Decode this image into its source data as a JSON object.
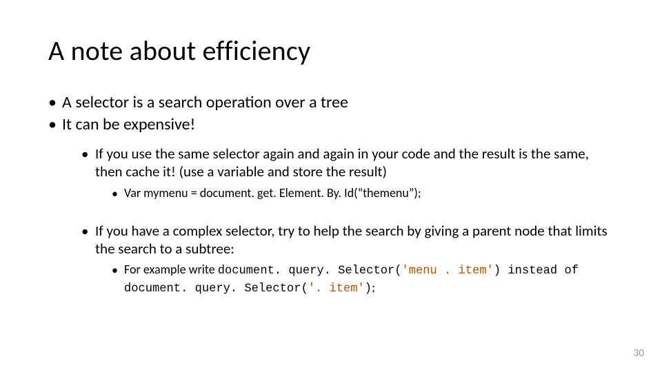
{
  "title": "A note about efficiency",
  "b1": "A selector is a search operation over a tree",
  "b2": "It can be expensive!",
  "b3": "If you use the same selector again and again in your code and the result is the same, then cache it! (use a variable and store the result)",
  "b4": "Var mymenu = document. get. Element. By. Id(“themenu”);",
  "b5": "If you have a complex selector, try to help the search by giving a parent node that limits the search to a subtree:",
  "ex": {
    "lead": "For example write ",
    "code1_a": "document. query. Selector(",
    "code1_str": "'menu . item'",
    "code1_b": ") ",
    "mid": "instead of ",
    "code2_a": "document. query. Selector(",
    "code2_str": "'. item'",
    "code2_b": ")",
    "tail": ";"
  },
  "page": "30"
}
